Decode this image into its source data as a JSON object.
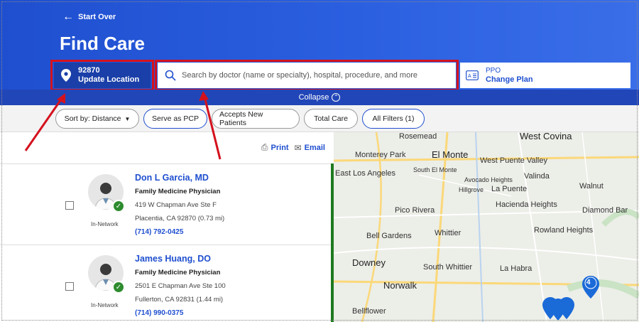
{
  "header": {
    "start_over": "Start Over",
    "title": "Find Care",
    "location": {
      "zip": "92870",
      "action": "Update Location"
    },
    "search": {
      "placeholder": "Search by doctor (name or specialty), hospital, procedure, and more",
      "value": ""
    },
    "plan": {
      "type": "PPO",
      "action": "Change Plan"
    },
    "collapse": "Collapse"
  },
  "filters": {
    "sort": "Sort by: Distance",
    "chips": [
      "Serve as PCP",
      "Accepts New Patients",
      "Total Care",
      "All Filters (1)"
    ]
  },
  "list_tools": {
    "print": "Print",
    "email": "Email"
  },
  "providers": [
    {
      "name": "Don L Garcia, MD",
      "specialty": "Family Medicine Physician",
      "address1": "419 W Chapman Ave Ste F",
      "address2": "Placentia, CA 92870 (0.73 mi)",
      "phone": "(714) 792-0425",
      "network": "In-Network"
    },
    {
      "name": "James Huang, DO",
      "specialty": "Family Medicine Physician",
      "address1": "2501 E Chapman Ave Ste 100",
      "address2": "Fullerton, CA 92831 (1.44 mi)",
      "phone": "(714) 990-0375",
      "network": "In-Network"
    }
  ],
  "map": {
    "places": [
      "Rosemead",
      "West Covina",
      "Monterey Park",
      "El Monte",
      "West Puente Valley",
      "East Los Angeles",
      "South El Monte",
      "Valinda",
      "Avocado Heights",
      "Hillgrove",
      "La Puente",
      "Walnut",
      "Pico Rivera",
      "Hacienda Heights",
      "Diamond Bar",
      "Bell Gardens",
      "Whittier",
      "Rowland Heights",
      "Downey",
      "South Whittier",
      "La Habra",
      "Norwalk",
      "Bellflower"
    ],
    "cluster_count": "4"
  },
  "colors": {
    "brand_blue": "#1f4fcf",
    "in_network_green": "#2e8b2e",
    "annotation_red": "#d4121e"
  }
}
